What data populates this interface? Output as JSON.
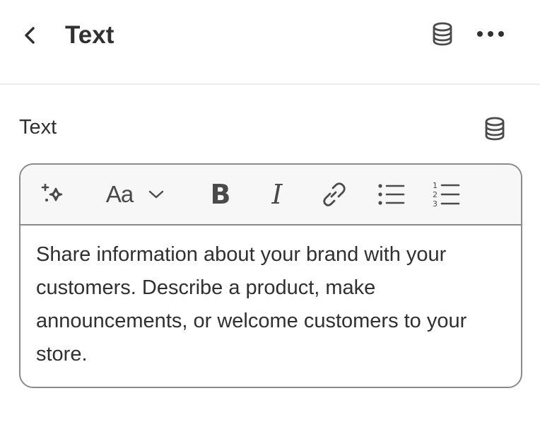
{
  "header": {
    "title": "Text",
    "back_icon": "chevron-left-icon",
    "dynamic_source_icon": "database-icon",
    "more_icon": "more-horizontal-icon"
  },
  "field": {
    "label": "Text",
    "dynamic_source_icon": "database-icon"
  },
  "toolbar": {
    "items": [
      {
        "name": "ai-generate",
        "icon": "sparkle-icon"
      },
      {
        "name": "font-style",
        "icon": "font-style-icon",
        "label": "Aa",
        "dropdown_icon": "chevron-down-icon"
      },
      {
        "name": "bold",
        "icon": "bold-icon",
        "label": "B"
      },
      {
        "name": "italic",
        "icon": "italic-icon",
        "label": "I"
      },
      {
        "name": "link",
        "icon": "link-icon"
      },
      {
        "name": "bulleted-list",
        "icon": "bulleted-list-icon"
      },
      {
        "name": "numbered-list",
        "icon": "numbered-list-icon"
      }
    ]
  },
  "editor": {
    "content": "Share information about your brand with your customers. Describe a product, make announcements, or welcome customers to your store."
  },
  "colors": {
    "text": "#303030",
    "icon": "#4a4a4a",
    "border": "#8a8a8a",
    "toolbar_bg": "#f7f7f7",
    "divider": "#ececec"
  }
}
